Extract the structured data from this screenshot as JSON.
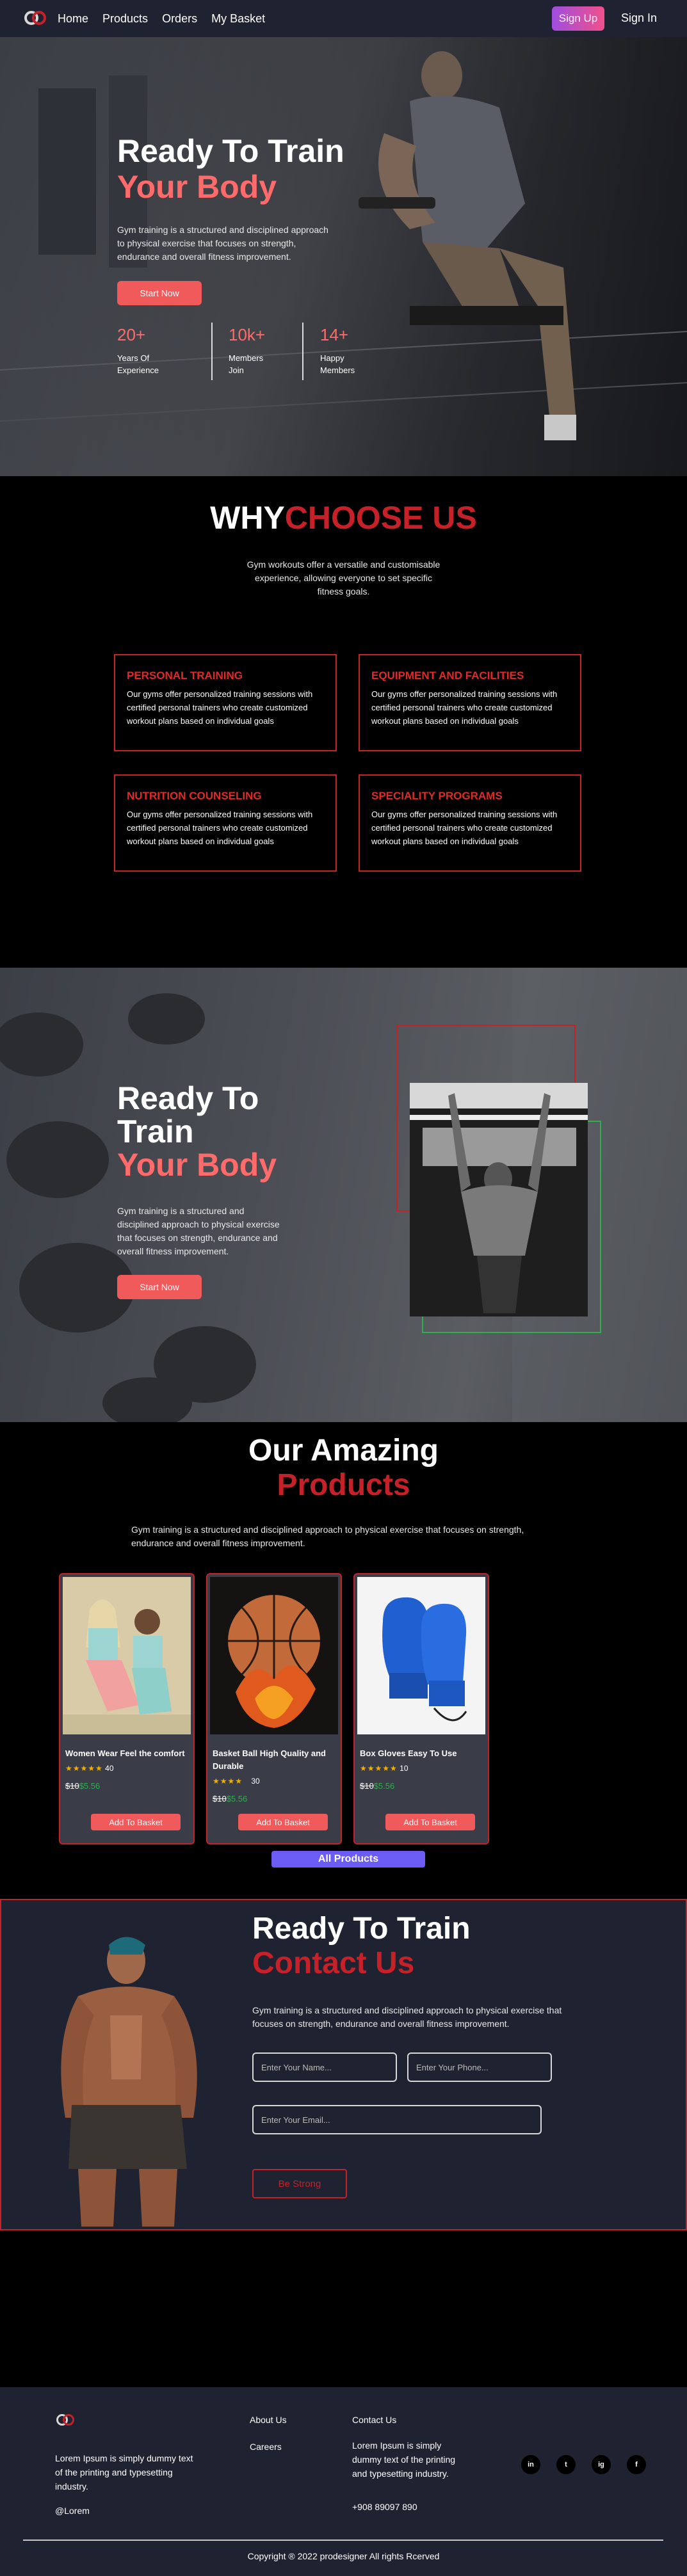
{
  "nav": {
    "links": [
      "Home",
      "Products",
      "Orders",
      "My Basket"
    ],
    "signup": "Sign Up",
    "signin": "Sign In"
  },
  "hero": {
    "title_line1": "Ready To Train",
    "title_line2": "Your Body",
    "description": "Gym training is a structured and disciplined approach to physical exercise that focuses on strength, endurance and overall fitness improvement.",
    "button": "Start Now",
    "stats": [
      {
        "value": "20+",
        "label_line1": "Years Of",
        "label_line2": "Experience"
      },
      {
        "value": "10k+",
        "label_line1": "Members",
        "label_line2": "Join"
      },
      {
        "value": "14+",
        "label_line1": "Happy",
        "label_line2": "Members"
      }
    ]
  },
  "why": {
    "title_white": "WHY",
    "title_red": "CHOOSE US",
    "description": "Gym workouts offer a versatile and customisable experience, allowing everyone to set specific fitness goals.",
    "cards": [
      {
        "title": "PERSONAL TRAINING",
        "text": "Our gyms offer personalized training sessions with certified personal trainers who create customized workout plans based on individual goals"
      },
      {
        "title": "EQUIPMENT AND FACILITIES",
        "text": "Our gyms offer personalized training sessions with certified personal trainers who create customized workout plans based on individual goals"
      },
      {
        "title": "NUTRITION COUNSELING",
        "text": "Our gyms offer personalized training sessions with certified personal trainers who create customized workout plans based on individual goals"
      },
      {
        "title": "SPECIALITY PROGRAMS",
        "text": "Our gyms offer personalized training sessions with certified personal trainers who create customized workout plans based on individual goals"
      }
    ]
  },
  "banner2": {
    "title_line1": "Ready To",
    "title_line2": "Train",
    "title_line3": "Your Body",
    "description": "Gym training is a structured and disciplined approach to physical exercise that focuses on strength, endurance and overall fitness improvement.",
    "button": "Start Now"
  },
  "products": {
    "title_line1": "Our Amazing",
    "title_line2": "Products",
    "description": "Gym training is a structured and disciplined approach to physical exercise that focuses on strength, endurance and overall fitness improvement.",
    "items": [
      {
        "name": "Women Wear Feel the comfort",
        "stars": "★★★★★",
        "rating": "40",
        "old_price": "$10",
        "new_price": "$5.56",
        "button": "Add To Basket"
      },
      {
        "name": "Basket Ball High Quality and Durable",
        "stars": "★★★★",
        "rating": "30",
        "old_price": "$10",
        "new_price": "$5.56",
        "button": "Add To Basket"
      },
      {
        "name": "Box Gloves Easy To Use",
        "stars": "★★★★★",
        "rating": "10",
        "old_price": "$10",
        "new_price": "$5.56",
        "button": "Add To Basket"
      }
    ],
    "all_button": "All Products"
  },
  "contact": {
    "title_line1": "Ready To Train",
    "title_line2": "Contact Us",
    "description": "Gym training is a structured and disciplined approach to physical exercise that focuses on strength, endurance and overall fitness improvement.",
    "name_placeholder": "Enter Your Name...",
    "phone_placeholder": "Enter Your Phone...",
    "email_placeholder": "Enter Your Email...",
    "button": "Be Strong"
  },
  "footer": {
    "about": "Lorem Ipsum is simply dummy text of the printing and typesetting industry.",
    "handle": "@Lorem",
    "links": [
      "About Us",
      "Careers"
    ],
    "contact_title": "Contact Us",
    "contact_text": "Lorem Ipsum is simply dummy text of the printing and typesetting industry.",
    "phone": "+908 89097 890",
    "social": [
      "in",
      "t",
      "ig",
      "f"
    ],
    "copyright": "Copyright ® 2022 prodesigner All rights Rcerved"
  },
  "colors": {
    "accent_red": "#c62028",
    "accent_pink": "#f05a5a",
    "nav_bg": "#1f2230",
    "button_purple": "#6b5cf5"
  }
}
